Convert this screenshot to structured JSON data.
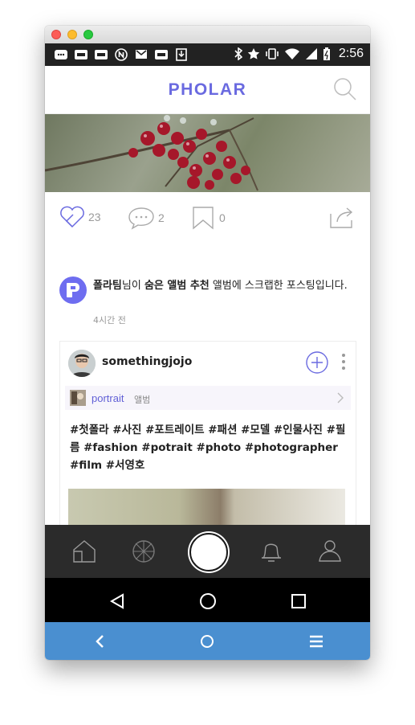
{
  "status_bar": {
    "time": "2:56"
  },
  "app_bar": {
    "logo": "PHOLAR"
  },
  "post_actions": {
    "likes": "23",
    "comments": "2",
    "bookmarks": "0"
  },
  "notice": {
    "sender": "폴라팀",
    "text_a": "님이 ",
    "album": "숨은 앨범 추천",
    "text_b": " 앨범에 스크랩한 포스팅입니다.",
    "time": "4시간 전"
  },
  "card": {
    "username": "somethingjojo",
    "album_name": "portrait",
    "album_label": "앨범",
    "tags": "#첫폴라 #사진 #포트레이트 #패션 #모델 #인물사진 #필름 #fashion #potrait  #photo #photographer #film #서영호"
  },
  "colors": {
    "accent": "#6a6ae0",
    "tab_bg": "#2b2b2b",
    "browser_bar": "#4a8fd0"
  }
}
